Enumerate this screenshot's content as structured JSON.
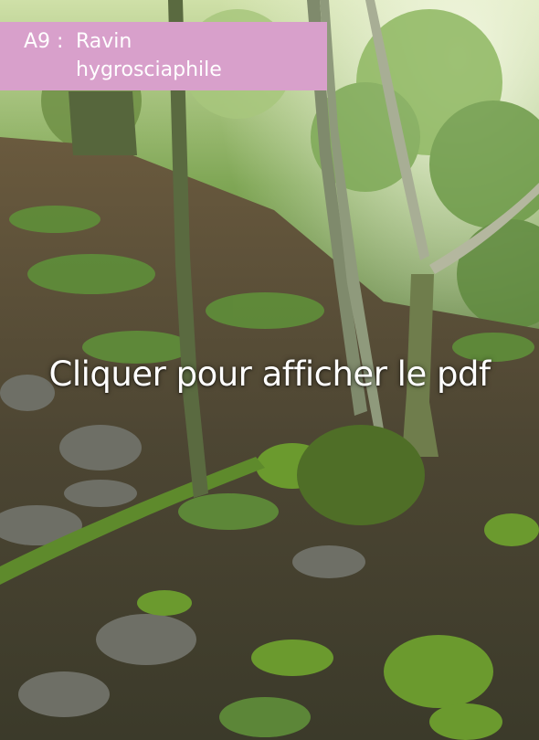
{
  "card": {
    "title_code": "A9 :",
    "title_line1": "Ravin",
    "title_line2": "hygrosciaphile",
    "cta_label": "Cliquer pour afficher le pdf"
  },
  "colors": {
    "banner": "#d8a0cb",
    "text": "#ffffff"
  }
}
